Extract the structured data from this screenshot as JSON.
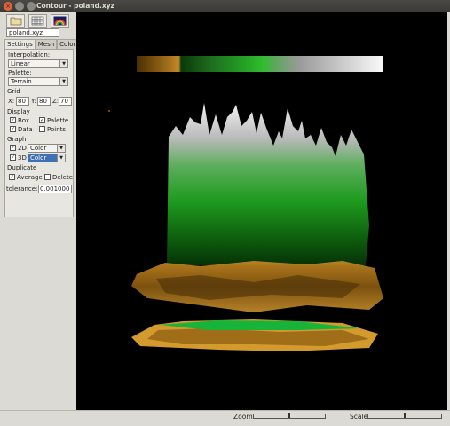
{
  "window": {
    "title": "Contour - poland.xyz"
  },
  "file": {
    "value": "poland.xyz"
  },
  "tabs": [
    "Settings",
    "Mesh",
    "Color"
  ],
  "interpolation": {
    "label": "Interpolation:",
    "value": "Linear"
  },
  "palette": {
    "label": "Palette:",
    "value": "Terrain"
  },
  "grid": {
    "label": "Grid",
    "x_label": "X:",
    "x": "80",
    "y_label": "Y:",
    "y": "80",
    "z_label": "Z:",
    "z": "70"
  },
  "display": {
    "label": "Display",
    "box": {
      "label": "Box",
      "checked": true
    },
    "palette": {
      "label": "Palette",
      "checked": true
    },
    "data": {
      "label": "Data",
      "checked": true
    },
    "points": {
      "label": "Points",
      "checked": false
    }
  },
  "graph": {
    "label": "Graph",
    "g2d": {
      "label": "2D",
      "checked": true,
      "value": "Color"
    },
    "g3d": {
      "label": "3D",
      "checked": true,
      "value": "Color"
    }
  },
  "duplicate": {
    "label": "Duplicate",
    "average": {
      "label": "Average",
      "checked": true
    },
    "delete": {
      "label": "Delete",
      "checked": false
    }
  },
  "tolerance": {
    "label": "tolerance:",
    "value": "0.001000"
  },
  "status": {
    "zoom_label": "Zoom",
    "scale_label": "Scale",
    "zoom_level": 0.5,
    "scale_level": 0.5
  },
  "colors": {
    "accent": "#3f6fb5",
    "background": "#000000"
  },
  "icons": [
    "folder-icon",
    "grid-icon",
    "palette-icon"
  ]
}
